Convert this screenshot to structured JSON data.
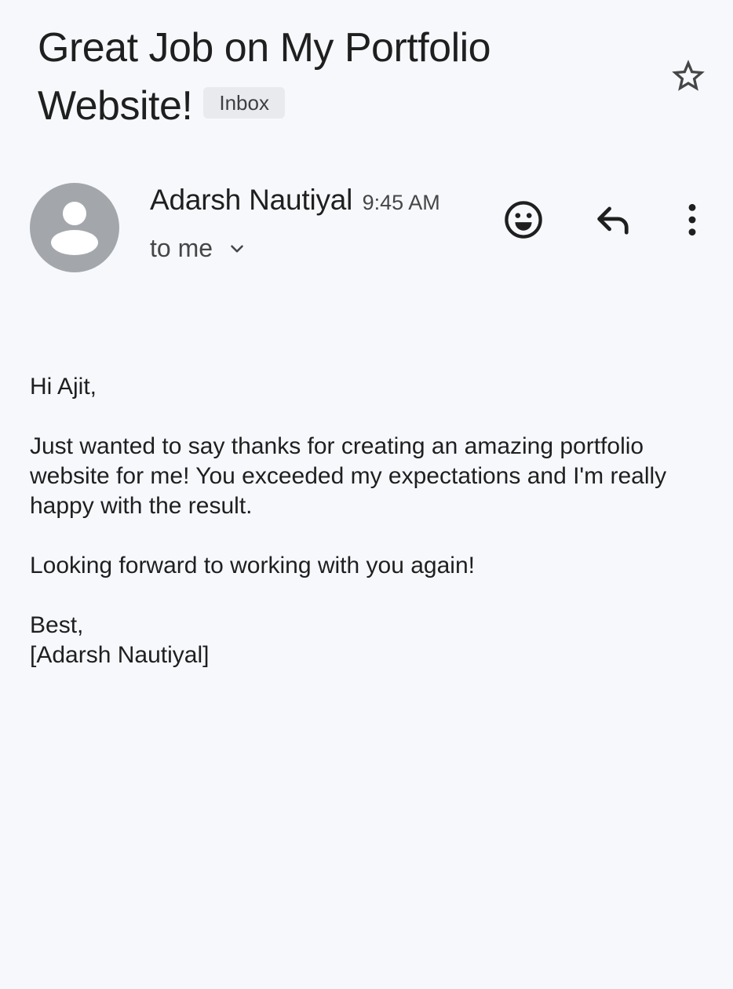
{
  "message": {
    "subject": "Great Job on My Portfolio Website!",
    "label": "Inbox",
    "sender": {
      "name": "Adarsh Nautiyal",
      "time": "9:45 AM",
      "recipient": "to me"
    },
    "body": {
      "greeting": "Hi Ajit,",
      "paragraph1": "Just wanted to say thanks for creating an amazing portfolio website for me! You exceeded my expectations and I'm really happy with the result.",
      "paragraph2": "Looking forward to working with you again!",
      "closing": "Best,",
      "signature": "[Adarsh Nautiyal]"
    }
  },
  "icons": {
    "star": "star-outline-icon",
    "avatar": "person-avatar-icon",
    "recipient_expand": "chevron-down-icon",
    "emoji": "emoji-reaction-icon",
    "reply": "reply-icon",
    "more": "more-vert-icon"
  },
  "colors": {
    "background": "#f6f8fc",
    "avatar_bg": "#a3a7ac",
    "label_chip_bg": "#e9eaed",
    "text_primary": "#1f1f1f",
    "text_secondary": "#444746"
  }
}
